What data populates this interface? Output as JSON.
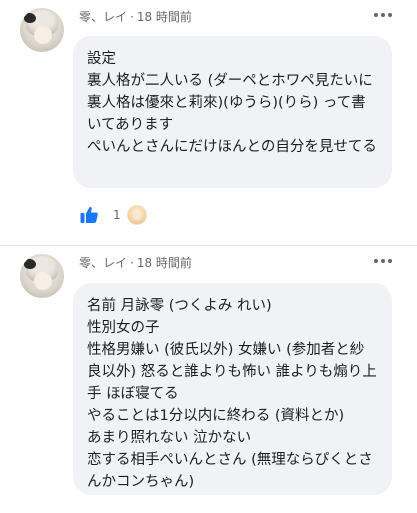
{
  "comments": [
    {
      "author": "零、レイ",
      "separator": "·",
      "time": "18 時間前",
      "text": "設定\n裏人格が二人いる (ダーペとホワペ見たいに裏人格は優來と莉來)(ゆうら)(りら) って書いてあります\nぺいんとさんにだけほんとの自分を見せてる",
      "reactions": {
        "icon": "thumbs-up-icon",
        "count": "1",
        "reactor": "reactor-avatar"
      }
    },
    {
      "author": "零、レイ",
      "separator": "·",
      "time": "18 時間前",
      "text": "名前 月詠零 (つくよみ れい)\n性別女の子\n性格男嫌い (彼氏以外) 女嫌い (参加者と紗良以外) 怒ると誰よりも怖い 誰よりも煽り上手 ほぼ寝てる\nやることは1分以内に終わる (資料とか)\nあまり照れない 泣かない\n恋する相手ぺいんとさん (無理ならぴくとさんかコンちゃん)"
    }
  ],
  "colors": {
    "bubble": "#f0f2f5",
    "like_blue": "#1877f2",
    "meta_text": "#65676b"
  }
}
